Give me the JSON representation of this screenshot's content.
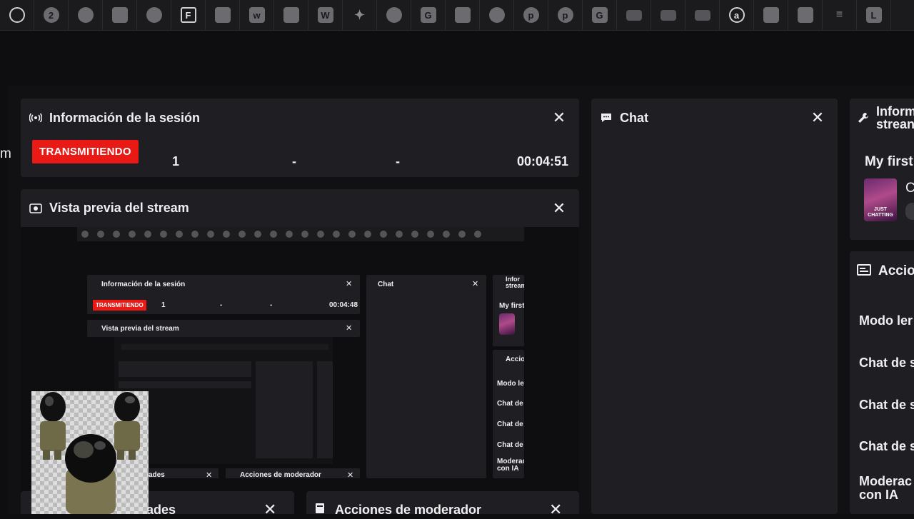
{
  "bookmarks": [
    {
      "icon": "ring-logo-icon",
      "glyph": ""
    },
    {
      "icon": "2-logo-icon",
      "glyph": "2"
    },
    {
      "icon": "ball-icon",
      "glyph": ""
    },
    {
      "icon": "box-icon",
      "glyph": ""
    },
    {
      "icon": "ornament-icon",
      "glyph": ""
    },
    {
      "icon": "f-logo-icon",
      "glyph": "F"
    },
    {
      "icon": "gray-square-icon",
      "glyph": ""
    },
    {
      "icon": "webflow-icon",
      "glyph": "w"
    },
    {
      "icon": "portrait-icon",
      "glyph": ""
    },
    {
      "icon": "w-logo-icon",
      "glyph": "W"
    },
    {
      "icon": "sparkle-icon",
      "glyph": "✦"
    },
    {
      "icon": "notch-logo-icon",
      "glyph": ""
    },
    {
      "icon": "g-logo-icon",
      "glyph": "G"
    },
    {
      "icon": "avatar-icon",
      "glyph": ""
    },
    {
      "icon": "half-circle-icon",
      "glyph": ""
    },
    {
      "icon": "pinterest-icon",
      "glyph": "p"
    },
    {
      "icon": "pinterest-icon",
      "glyph": "p"
    },
    {
      "icon": "g-logo-icon",
      "glyph": "G"
    },
    {
      "icon": "youtube-icon",
      "glyph": ""
    },
    {
      "icon": "youtube-icon",
      "glyph": ""
    },
    {
      "icon": "youtube-icon",
      "glyph": ""
    },
    {
      "icon": "a-logo-icon",
      "glyph": "a"
    },
    {
      "icon": "gradient-square-icon",
      "glyph": ""
    },
    {
      "icon": "gradient-square-icon",
      "glyph": ""
    },
    {
      "icon": "lines-icon",
      "glyph": "≡"
    },
    {
      "icon": "l-logo-icon",
      "glyph": "L"
    }
  ],
  "side_letter": "m",
  "session": {
    "title": "Información de la sesión",
    "badge": "TRANSMITIENDO",
    "viewers": "1",
    "stat2": "-",
    "stat3": "-",
    "uptime": "00:04:51"
  },
  "preview": {
    "title": "Vista previa del stream",
    "inner": {
      "session_title": "Información de la sesión",
      "badge": "TRANSMITIENDO",
      "viewers": "1",
      "stat2": "-",
      "stat3": "-",
      "uptime": "00:04:48",
      "preview_title": "Vista previa del stream",
      "chat_title": "Chat",
      "info_title": "Infor stream",
      "my_first": "My first",
      "acciones": "Accio",
      "modo": "Modo ler",
      "chat1": "Chat de",
      "chat2": "Chat de",
      "chat3": "Chat de",
      "moder": "Moderac con IA",
      "bottom_left": "ades",
      "bottom_right": "Acciones de moderador"
    }
  },
  "chat": {
    "title": "Chat"
  },
  "stream_info": {
    "title_line1": "Inform",
    "title_line2": "strean",
    "stream_title": "My first",
    "category_initial": "C",
    "thumb_text": "JUST CHATTING"
  },
  "mod_actions": {
    "title": "Accio",
    "items": [
      "Modo ler",
      "Chat de s",
      "Chat de s",
      "Chat de s"
    ],
    "last_line1": "Moderac",
    "last_line2": "con IA"
  },
  "bottom": {
    "left_title": "ades",
    "right_title": "Acciones de moderador"
  }
}
